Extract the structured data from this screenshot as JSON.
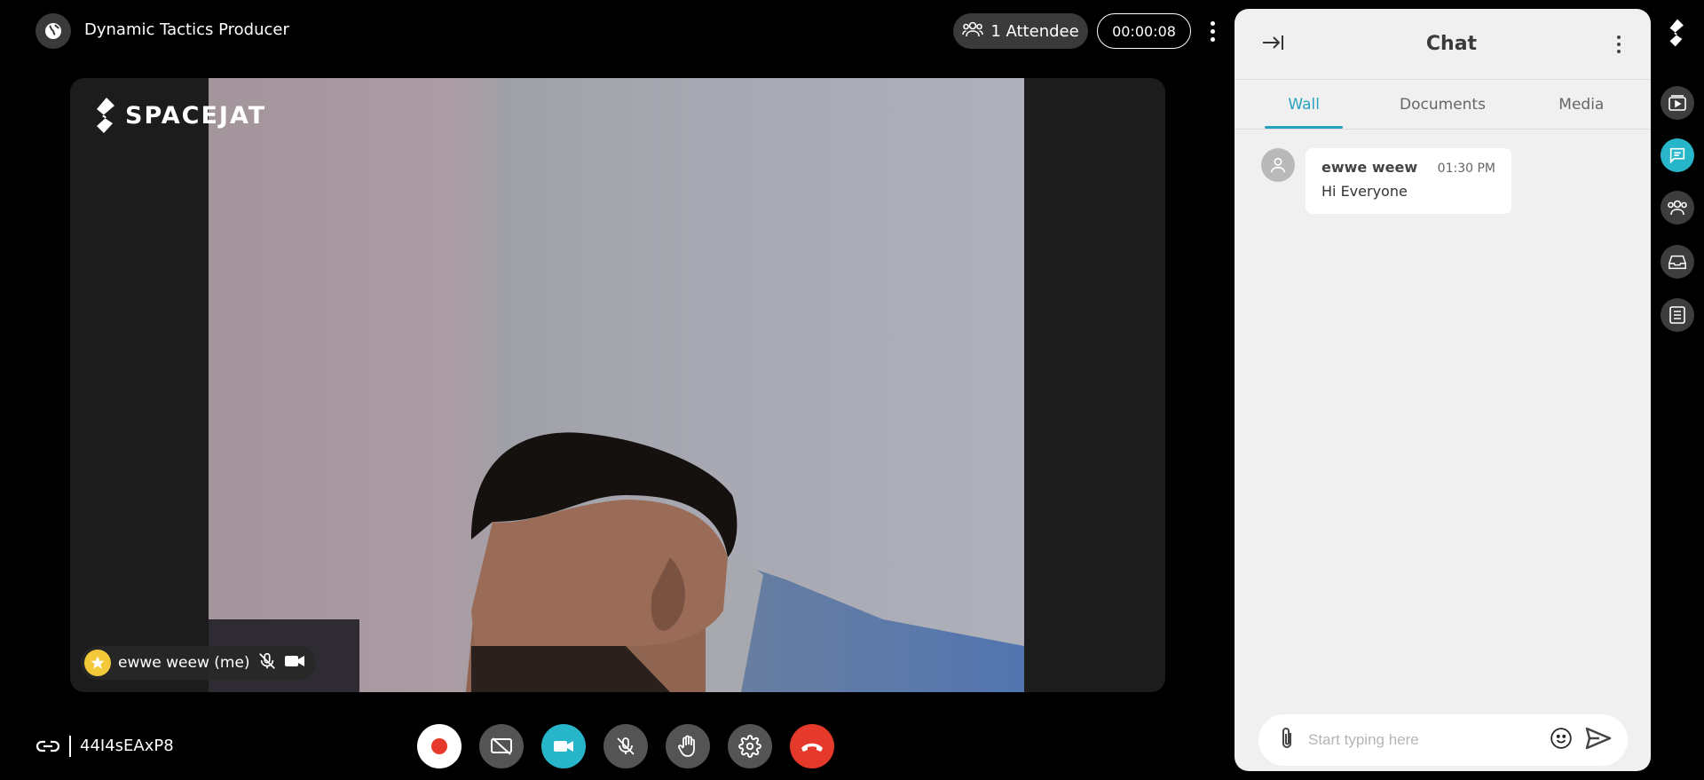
{
  "header": {
    "event_title": "Dynamic Tactics Producer",
    "attendees_label": "1 Attendee",
    "timer": "00:00:08",
    "globe_icon": "globe-icon",
    "more_icon": "more-vertical-icon"
  },
  "stage": {
    "brand": "SPACEJAT",
    "participant_label": "ewwe weew (me)",
    "badge_color": "#f3c93a"
  },
  "footer": {
    "meeting_id": "44I4sEAxP8",
    "controls": [
      {
        "name": "record",
        "icon": "record-icon"
      },
      {
        "name": "screen-share-off",
        "icon": "screen-share-off-icon"
      },
      {
        "name": "camera",
        "icon": "video-camera-icon"
      },
      {
        "name": "mic-muted",
        "icon": "mic-off-icon"
      },
      {
        "name": "raise-hand",
        "icon": "hand-icon"
      },
      {
        "name": "settings",
        "icon": "gear-icon"
      },
      {
        "name": "leave-call",
        "icon": "phone-hangup-icon"
      }
    ]
  },
  "chat": {
    "title": "Chat",
    "tabs": [
      "Wall",
      "Documents",
      "Media"
    ],
    "active_tab": "Wall",
    "messages": [
      {
        "author": "ewwe weew",
        "time": "01:30 PM",
        "text": "Hi Everyone"
      }
    ],
    "composer_placeholder": "Start typing here"
  },
  "rail": {
    "items": [
      "media-player-icon",
      "chat-icon",
      "people-icon",
      "inbox-icon",
      "list-icon"
    ],
    "active": "chat-icon"
  },
  "colors": {
    "accent": "#27b5ca",
    "leave": "#e53a2b",
    "tab_active": "#27a3c0"
  }
}
